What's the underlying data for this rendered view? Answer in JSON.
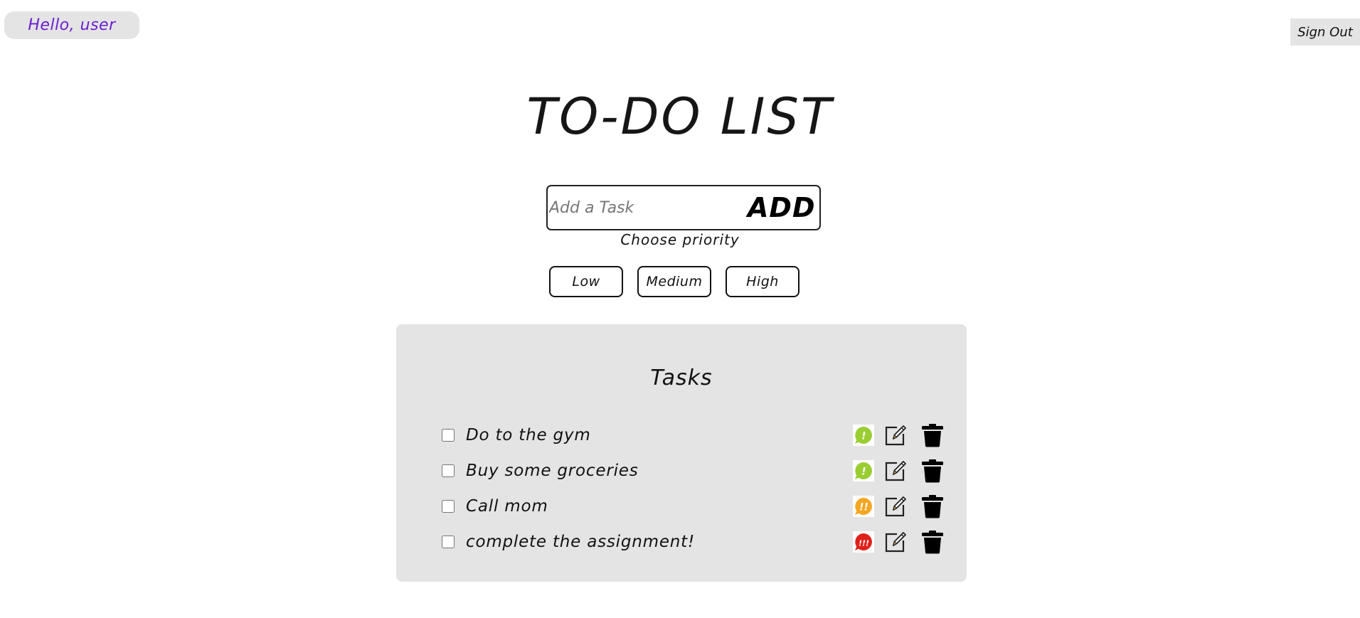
{
  "header": {
    "greeting": "Hello, user",
    "sign_out_label": "Sign Out"
  },
  "title": "TO-DO LIST",
  "add_task": {
    "placeholder": "Add a Task",
    "value": "",
    "add_label": "ADD"
  },
  "priority": {
    "label": "Choose priority",
    "options": [
      "Low",
      "Medium",
      "High"
    ]
  },
  "tasks": {
    "heading": "Tasks",
    "items": [
      {
        "text": "Do to the gym",
        "priority": "low",
        "priority_glyph": "!",
        "priority_color": "#9acd32",
        "checked": false
      },
      {
        "text": "Buy some groceries",
        "priority": "low",
        "priority_glyph": "!",
        "priority_color": "#9acd32",
        "checked": false
      },
      {
        "text": "Call mom",
        "priority": "medium",
        "priority_glyph": "!!",
        "priority_color": "#f5a623",
        "checked": false
      },
      {
        "text": "complete the assignment!",
        "priority": "high",
        "priority_glyph": "!!!",
        "priority_color": "#e0201a",
        "checked": false
      }
    ]
  },
  "icons": {
    "priority": "priority-badge-icon",
    "edit": "edit-icon",
    "delete": "trash-icon"
  },
  "colors": {
    "greeting_text": "#6a1fd1",
    "panel_bg": "#e4e4e4"
  }
}
